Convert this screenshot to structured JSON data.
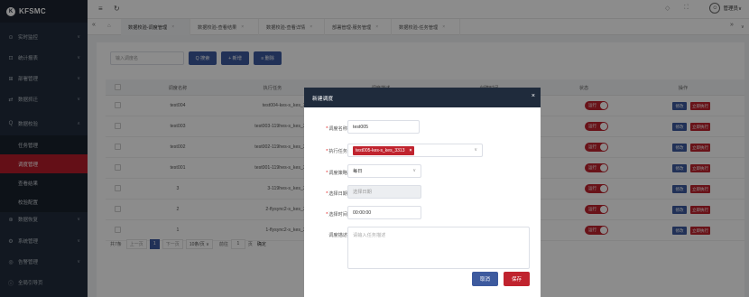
{
  "app": {
    "logo_mark": "K",
    "title": "KFSMC"
  },
  "topbar": {
    "menu_icon": "≡",
    "refresh_icon": "↻",
    "user_name": "管理员∨"
  },
  "sidebar": {
    "items": [
      {
        "label": "实时监控",
        "icon": "⊙"
      },
      {
        "label": "统计报表",
        "icon": "⊡"
      },
      {
        "label": "部署管理",
        "icon": "⊞"
      },
      {
        "label": "数据抓迁",
        "icon": "⇄"
      },
      {
        "label": "数据校验",
        "icon": "⊙"
      },
      {
        "label": "数据恢复",
        "icon": "⊛"
      },
      {
        "label": "系统管理",
        "icon": "⚙"
      },
      {
        "label": "告警管理",
        "icon": "◎"
      },
      {
        "label": "全局引导页",
        "icon": "ⓘ"
      }
    ],
    "sub_items": [
      {
        "label": "任务管理"
      },
      {
        "label": "调度管理"
      },
      {
        "label": "查看结果"
      },
      {
        "label": "校验配置"
      }
    ]
  },
  "tabs": [
    {
      "label": "数据校验-调度管理"
    },
    {
      "label": "数据校验-查看结果"
    },
    {
      "label": "数据校验-查看详情"
    },
    {
      "label": "部署管理-服务管理"
    },
    {
      "label": "数据校验-任务管理"
    }
  ],
  "toolbar": {
    "search_placeholder": "输入调度名",
    "search_label": "Q 搜索",
    "add_label": "+ 新增",
    "delete_label": "≡ 删除"
  },
  "table": {
    "columns": [
      "调度名称",
      "执行任务",
      "调度描述",
      "创建时间",
      "状态",
      "操作"
    ],
    "rows": [
      {
        "name": "test004",
        "task": "test004-kes-s_kes_3113"
      },
      {
        "name": "test003",
        "task": "test003-119hes-s_kes_3113"
      },
      {
        "name": "test002",
        "task": "test002-119hes-s_kes_3113"
      },
      {
        "name": "test001",
        "task": "test001-119hes-s_kes_3113"
      },
      {
        "name": "3",
        "task": "3-119hes-s_kes_3113"
      },
      {
        "name": "2",
        "task": "2-flysync2-s_kes_3113"
      },
      {
        "name": "1",
        "task": "1-flysync2-s_kes_3113"
      }
    ],
    "status_label": "运行",
    "edit_label": "修改",
    "run_label": "立即执行"
  },
  "pager": {
    "total": "共7条",
    "prev": "上一页",
    "current": "1",
    "next": "下一页",
    "per_page": "10条/页 ∨",
    "goto_label": "前往",
    "goto_value": "1",
    "page_unit": "页",
    "confirm": "确定"
  },
  "modal": {
    "title": "新建调度",
    "close": "×",
    "fields": {
      "name_label": "调度名称",
      "name_value": "test005",
      "task_label": "执行任务",
      "task_tag": "test005-kes-s_kes_3313",
      "task_tag_close": "×",
      "strategy_label": "调度策略",
      "strategy_value": "每日",
      "date_label": "选择日期",
      "date_placeholder": "选择日期",
      "time_label": "选择时间",
      "time_value": "00:00:00",
      "desc_label": "调度描述",
      "desc_placeholder": "请输入任务描述"
    },
    "cancel": "取消",
    "save": "保存"
  }
}
